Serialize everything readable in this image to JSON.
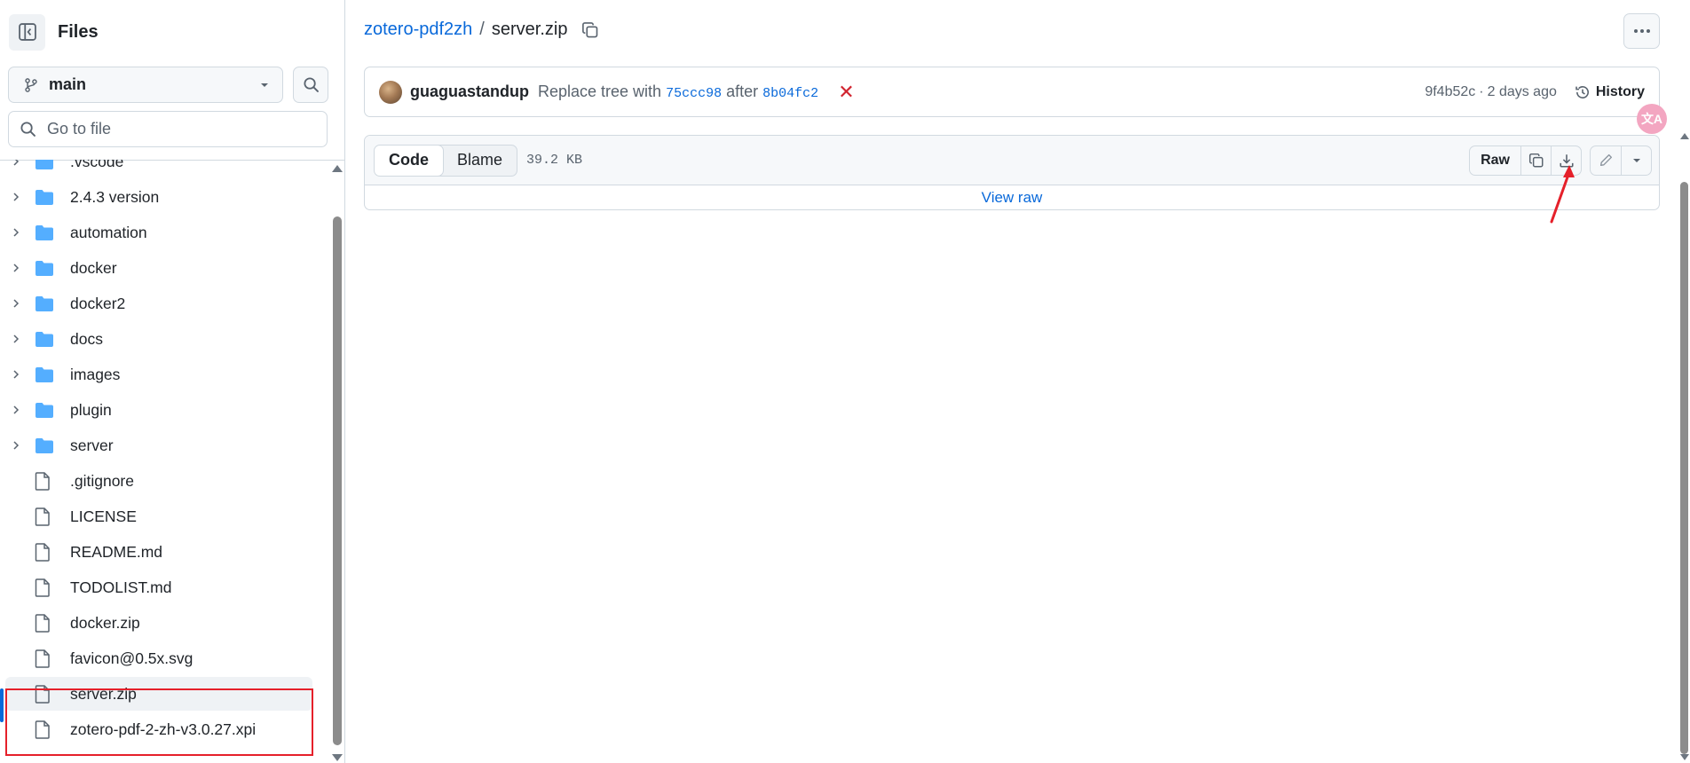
{
  "sidebar": {
    "title": "Files",
    "branch": "main",
    "goto_placeholder": "Go to file",
    "tree": [
      {
        "name": ".vscode",
        "type": "folder"
      },
      {
        "name": "2.4.3 version",
        "type": "folder"
      },
      {
        "name": "automation",
        "type": "folder"
      },
      {
        "name": "docker",
        "type": "folder"
      },
      {
        "name": "docker2",
        "type": "folder"
      },
      {
        "name": "docs",
        "type": "folder"
      },
      {
        "name": "images",
        "type": "folder"
      },
      {
        "name": "plugin",
        "type": "folder"
      },
      {
        "name": "server",
        "type": "folder"
      },
      {
        "name": ".gitignore",
        "type": "file"
      },
      {
        "name": "LICENSE",
        "type": "file"
      },
      {
        "name": "README.md",
        "type": "file"
      },
      {
        "name": "TODOLIST.md",
        "type": "file"
      },
      {
        "name": "docker.zip",
        "type": "file"
      },
      {
        "name": "favicon@0.5x.svg",
        "type": "file"
      },
      {
        "name": "server.zip",
        "type": "file",
        "selected": true
      },
      {
        "name": "zotero-pdf-2-zh-v3.0.27.xpi",
        "type": "file"
      }
    ]
  },
  "breadcrumb": {
    "repo": "zotero-pdf2zh",
    "separator": "/",
    "file": "server.zip"
  },
  "commit": {
    "author": "guaguastandup",
    "message_prefix": "Replace tree with",
    "sha_from": "75ccc98",
    "message_mid": "after",
    "sha_to": "8b04fc2",
    "status": "failure",
    "status_glyph": "✕",
    "short_sha": "9f4b52c",
    "dot": "·",
    "time": "2 days ago",
    "history_label": "History"
  },
  "translate_badge": "文A",
  "file": {
    "tabs": [
      "Code",
      "Blame"
    ],
    "active_tab": "Code",
    "size": "39.2 KB",
    "raw_label": "Raw",
    "view_raw": "View raw"
  },
  "colors": {
    "link": "#0969da",
    "annotation_red": "#e5202a",
    "folder": "#54aeff"
  }
}
